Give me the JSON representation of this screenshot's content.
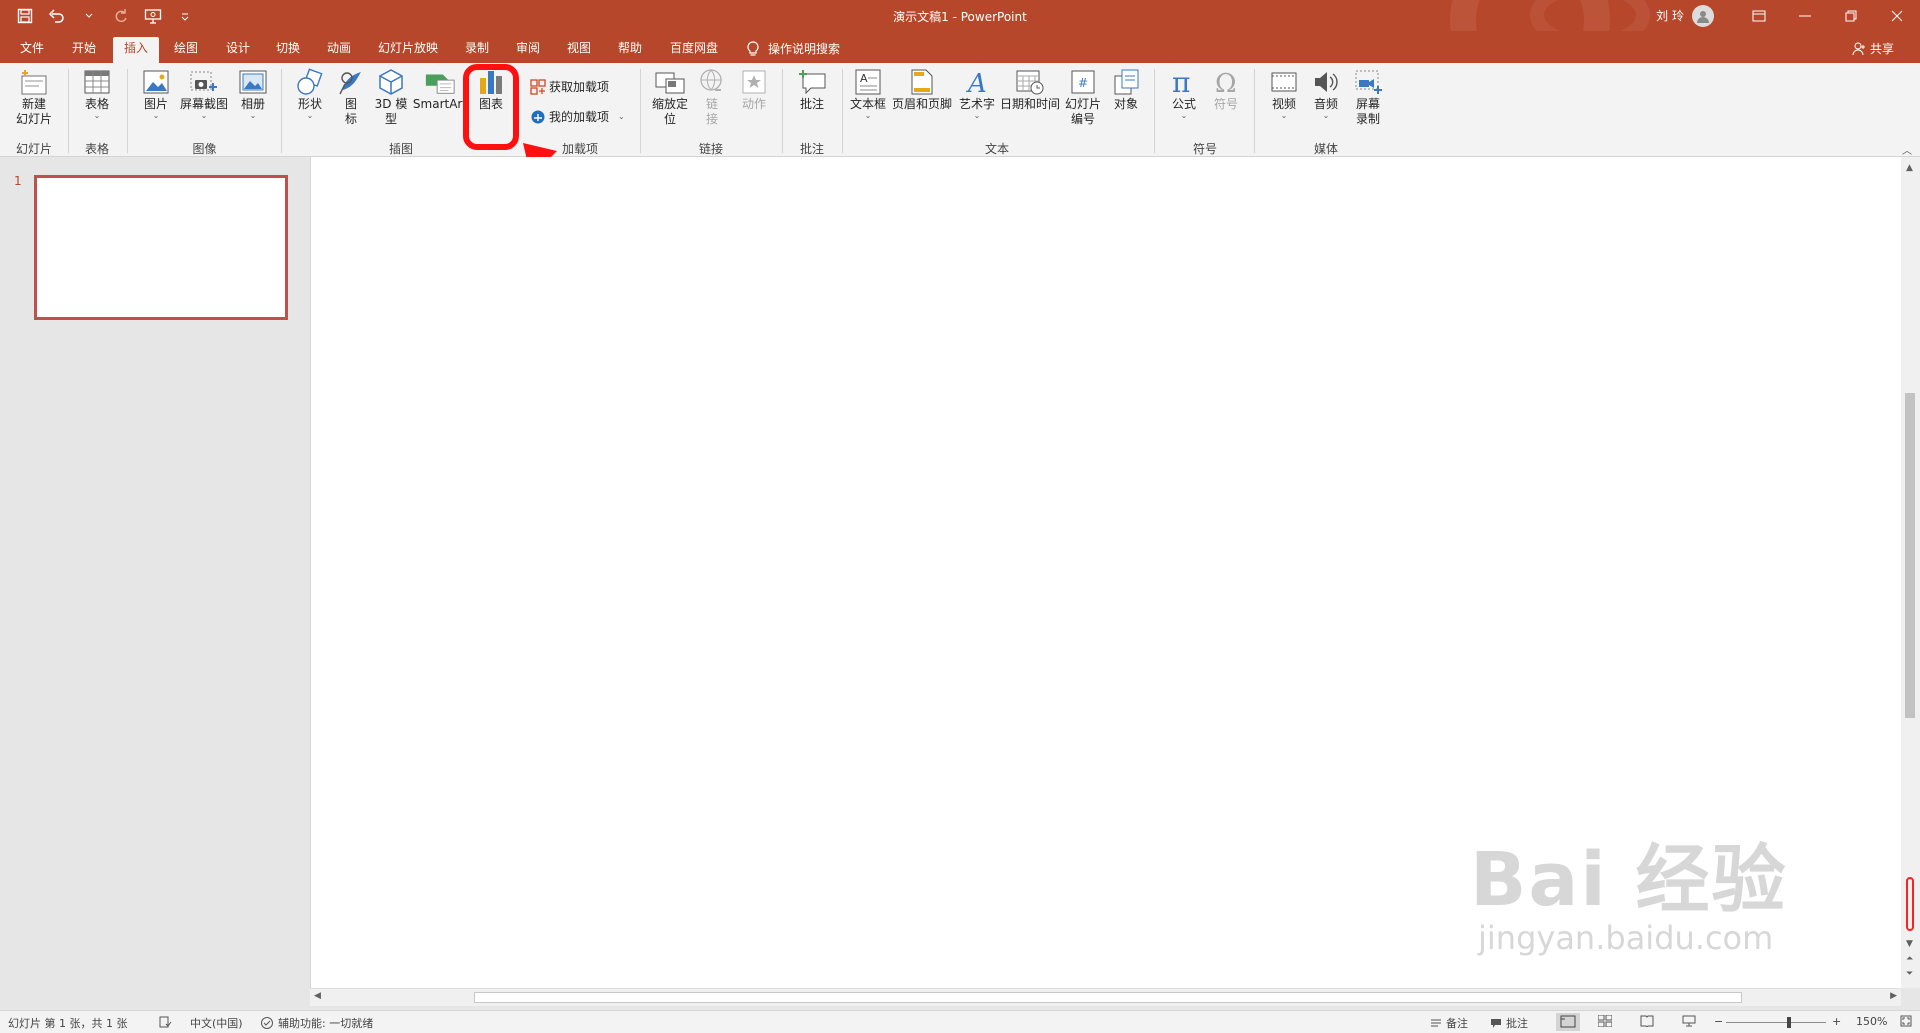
{
  "titlebar": {
    "title": "演示文稿1  -  PowerPoint",
    "user": "刘 玲",
    "accent": "#b7472a"
  },
  "tabs": [
    "文件",
    "开始",
    "插入",
    "绘图",
    "设计",
    "切换",
    "动画",
    "幻灯片放映",
    "录制",
    "审阅",
    "视图",
    "帮助",
    "百度网盘"
  ],
  "active_tab": "插入",
  "search": {
    "label": "操作说明搜索"
  },
  "share": {
    "label": "共享"
  },
  "ribbon": {
    "new_slide": {
      "line1": "新建",
      "line2": "幻灯片"
    },
    "table": "表格",
    "picture": "图片",
    "screenshot": "屏幕截图",
    "album": "相册",
    "shapes": "形状",
    "icons": {
      "line1": "图",
      "line2": "标"
    },
    "model3d": {
      "line1": "3D 模",
      "line2": "型"
    },
    "smartart": "SmartArt",
    "chart": "图表",
    "get_addins": "获取加载项",
    "my_addins": "我的加载项",
    "zoom": {
      "line1": "缩放定",
      "line2": "位"
    },
    "link": {
      "line1": "链",
      "line2": "接"
    },
    "action": "动作",
    "comment": "批注",
    "textbox": "文本框",
    "header_footer": "页眉和页脚",
    "wordart": "艺术字",
    "datetime": "日期和时间",
    "slide_number": {
      "line1": "幻灯片",
      "line2": "编号"
    },
    "object": "对象",
    "equation": "公式",
    "symbol": "符号",
    "video": "视频",
    "audio": "音频",
    "screen_recording": {
      "line1": "屏幕",
      "line2": "录制"
    },
    "groups": {
      "slides": "幻灯片",
      "tables": "表格",
      "images": "图像",
      "illustrations": "插图",
      "addins": "加载项",
      "links": "链接",
      "comments": "批注",
      "text": "文本",
      "symbols": "符号",
      "media": "媒体"
    }
  },
  "slides_panel": {
    "slide_number": "1"
  },
  "watermark": {
    "main": "Bai 经验",
    "sub": "jingyan.baidu.com"
  },
  "statusbar": {
    "slide_info": "幻灯片 第 1 张，共 1 张",
    "language": "中文(中国)",
    "accessibility": "辅助功能: 一切就绪",
    "notes": "备注",
    "comments": "批注",
    "zoom": "150%"
  }
}
